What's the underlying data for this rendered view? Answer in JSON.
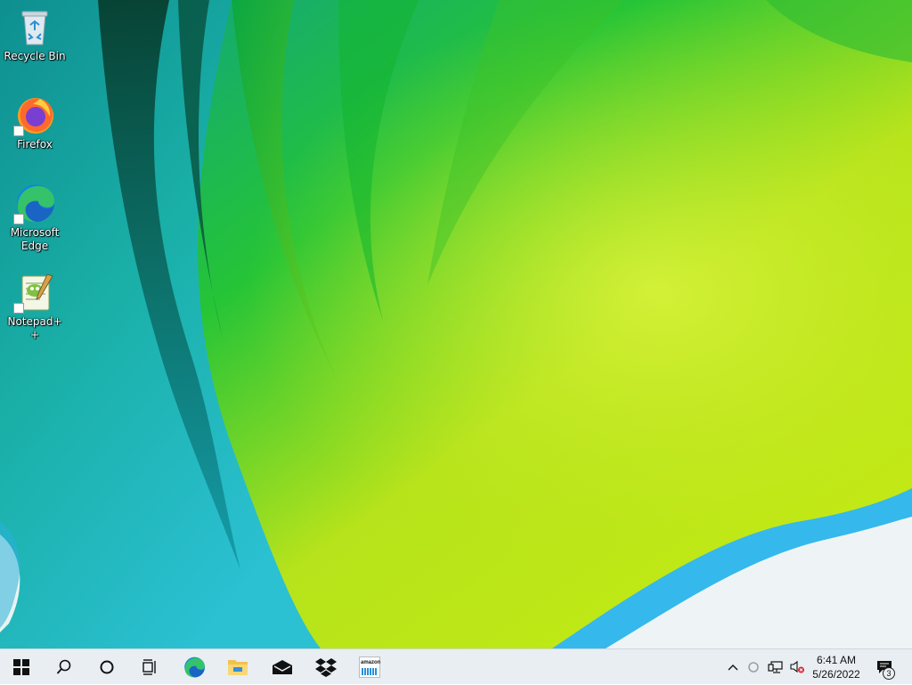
{
  "desktop": {
    "icons": [
      {
        "label": "Recycle Bin",
        "icon": "recycle-bin-icon"
      },
      {
        "label": "Firefox",
        "icon": "firefox-icon"
      },
      {
        "label": "Microsoft Edge",
        "icon": "edge-icon"
      },
      {
        "label": "Notepad++",
        "icon": "notepad-plus-plus-icon"
      }
    ]
  },
  "taskbar": {
    "pinned": [
      {
        "name": "start",
        "icon": "windows-logo-icon"
      },
      {
        "name": "search",
        "icon": "search-icon"
      },
      {
        "name": "cortana",
        "icon": "cortana-circle-icon"
      },
      {
        "name": "task-view",
        "icon": "task-view-icon"
      },
      {
        "name": "edge",
        "icon": "edge-icon"
      },
      {
        "name": "file-explorer",
        "icon": "folder-icon"
      },
      {
        "name": "mail",
        "icon": "mail-icon"
      },
      {
        "name": "dropbox",
        "icon": "dropbox-icon"
      },
      {
        "name": "amazon",
        "icon": "amazon-icon",
        "text": "amazon"
      }
    ],
    "tray": {
      "icons": [
        "chevron-up-icon",
        "sync-circle-icon",
        "network-icon",
        "volume-muted-icon"
      ],
      "time": "6:41 AM",
      "date": "5/26/2022",
      "notification_count": "3"
    }
  },
  "colors": {
    "taskbar_bg": "#e9eef3",
    "accent_green": "#b9e21a",
    "accent_teal": "#0a7a7c",
    "edge_blue": "#0c8bd8"
  }
}
